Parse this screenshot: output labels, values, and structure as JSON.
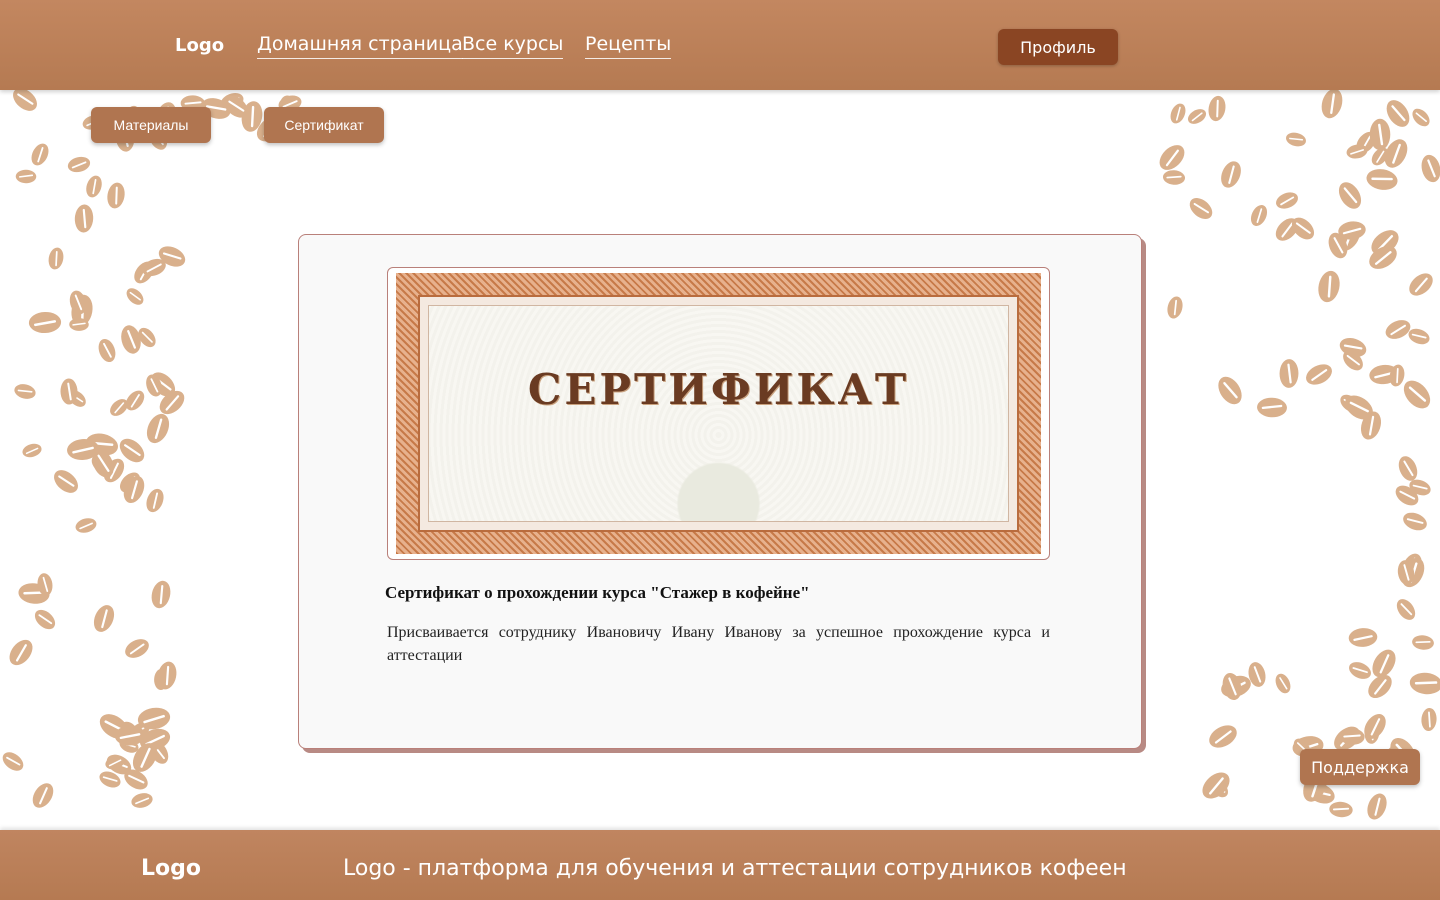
{
  "header": {
    "logo": "Logo",
    "nav": [
      {
        "label": "Домашняя страница"
      },
      {
        "label": "Все курсы"
      },
      {
        "label": "Рецепты"
      }
    ],
    "profile_label": "Профиль"
  },
  "tabs": [
    {
      "label": "Материалы"
    },
    {
      "label": "Сертификат"
    }
  ],
  "certificate": {
    "image_title": "СЕРТИФИКАТ",
    "heading": "Сертификат о прохождении курса \"Стажер в кофейне\"",
    "text": "Присваивается сотруднику Ивановичу Ивану Иванову за успешное прохождение курса и аттестации"
  },
  "support_label": "Поддержка",
  "footer": {
    "logo": "Logo",
    "tagline": "Logo - платформа для обучения и аттестации сотрудников кофеен"
  },
  "colors": {
    "accent": "#b57a52",
    "profile_button": "#8a4523",
    "bean": "#d9b08c"
  }
}
